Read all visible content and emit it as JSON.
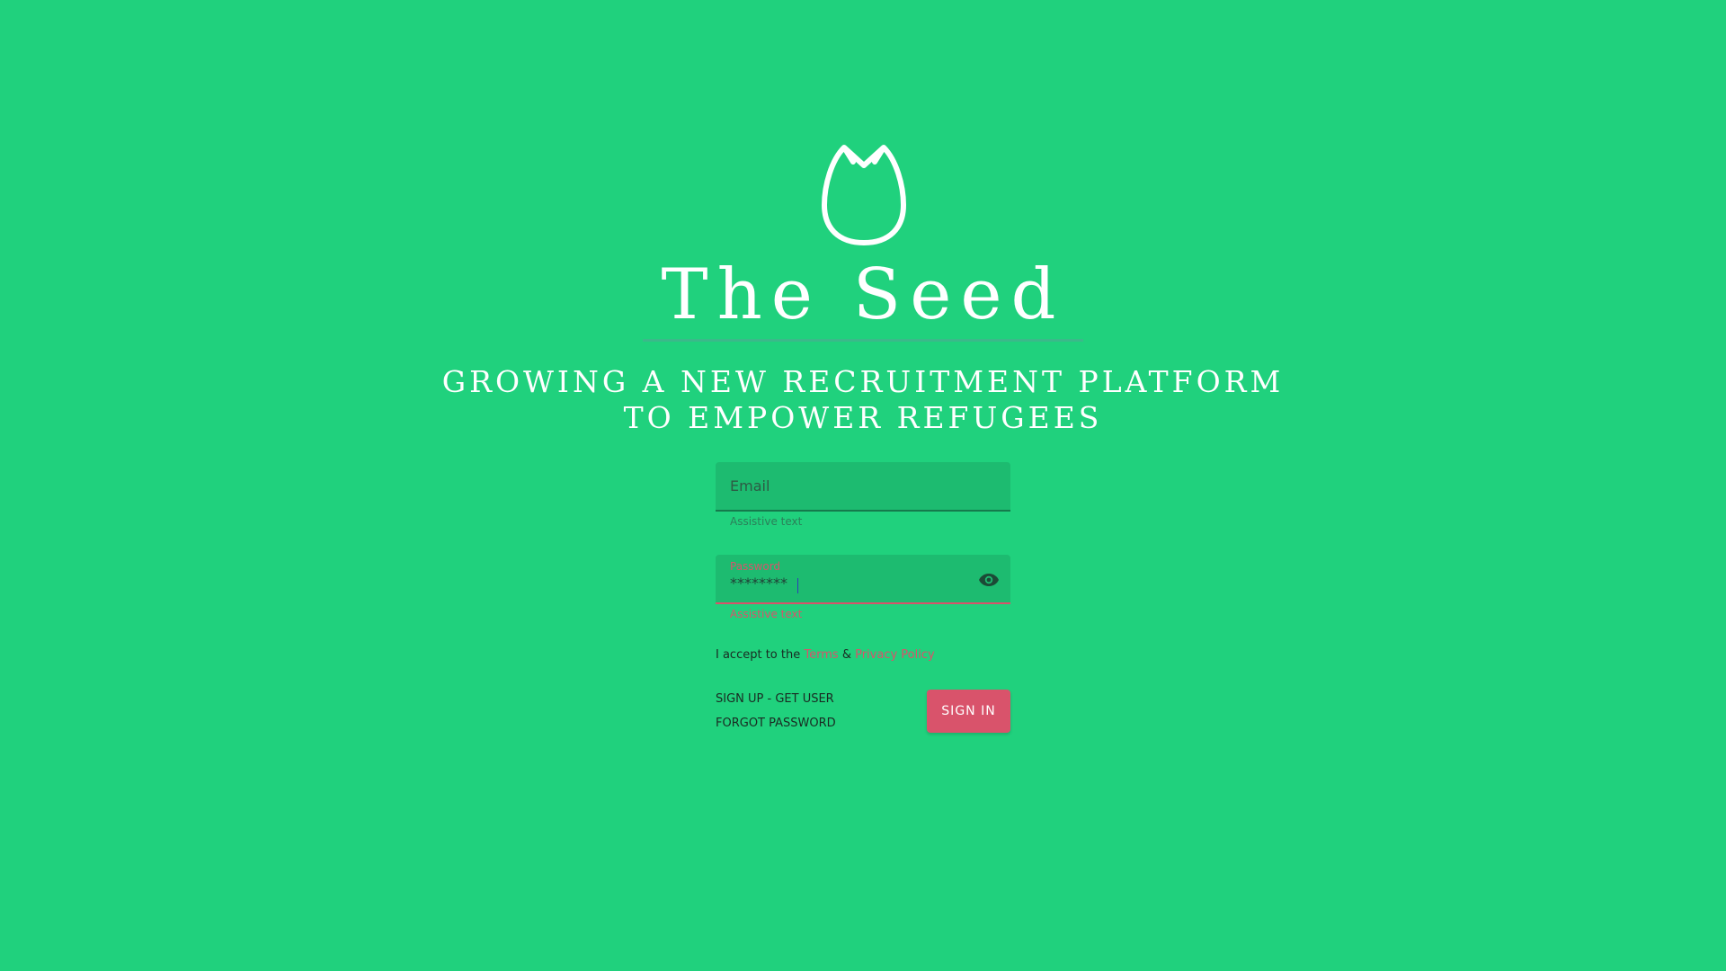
{
  "brand": {
    "logo_icon": "seed-icon",
    "name": "The Seed",
    "tagline_line1": "GROWING A NEW RECRUITMENT PLATFORM",
    "tagline_line2": "TO EMPOWER REFUGEES"
  },
  "form": {
    "email": {
      "placeholder": "Email",
      "value": "",
      "assistive_text": "Assistive text"
    },
    "password": {
      "label": "Password",
      "value": "********",
      "assistive_text": "Assistive text",
      "toggle_icon": "eye-icon"
    },
    "terms": {
      "prefix": "I accept to the",
      "terms_link": "Terms",
      "separator": "&",
      "privacy_link": "Privacy Policy"
    },
    "links": {
      "signup": "SIGN UP - GET USER",
      "forgot": "FORGOT PASSWORD"
    },
    "submit_label": "SIGN IN"
  },
  "colors": {
    "background": "#20d17d",
    "accent": "#d9536b",
    "field": "#1dbb70"
  }
}
